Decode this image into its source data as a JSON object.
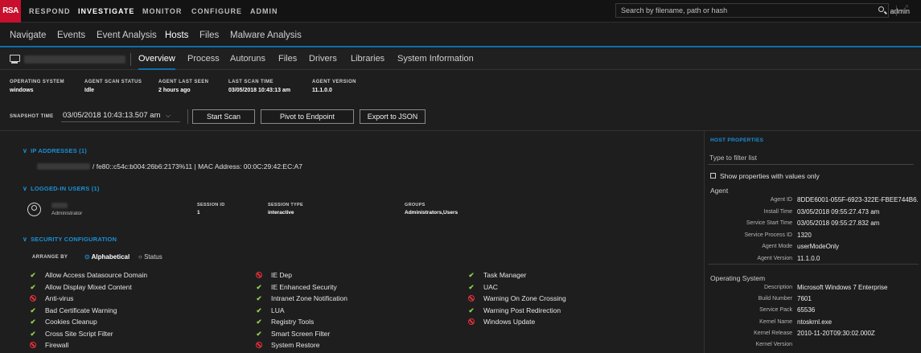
{
  "topbar": {
    "logo": "RSA",
    "nav": [
      "RESPOND",
      "INVESTIGATE",
      "MONITOR",
      "CONFIGURE",
      "ADMIN"
    ],
    "active": "INVESTIGATE",
    "user": "admin"
  },
  "subnav": {
    "items": [
      "Navigate",
      "Events",
      "Event Analysis",
      "Hosts",
      "Files",
      "Malware Analysis"
    ],
    "active": "Hosts"
  },
  "host": {
    "tabs": [
      "Overview",
      "Process",
      "Autoruns",
      "Files",
      "Drivers",
      "Libraries",
      "System Information"
    ],
    "active_tab": "Overview",
    "search_placeholder": "Search by filename, path or hash"
  },
  "summary": [
    {
      "label": "OPERATING SYSTEM",
      "value": "windows"
    },
    {
      "label": "AGENT SCAN STATUS",
      "value": "Idle"
    },
    {
      "label": "AGENT LAST SEEN",
      "value": "2 hours ago"
    },
    {
      "label": "LAST SCAN TIME",
      "value": "03/05/2018 10:43:13 am"
    },
    {
      "label": "AGENT VERSION",
      "value": "11.1.0.0"
    }
  ],
  "snapshot": {
    "label": "SNAPSHOT TIME",
    "value": "03/05/2018 10:43:13.507 am",
    "buttons": [
      "Start Scan",
      "Pivot to Endpoint",
      "Export to JSON"
    ]
  },
  "ip_section": {
    "title": "IP ADDRESSES (1)",
    "text": "/ fe80::c54c:b004:26b6:2173%11  |  MAC Address: 00:0C:29:42:EC:A7"
  },
  "users_section": {
    "title": "LOGGED-IN USERS (1)",
    "user_role": "Administrator",
    "columns": [
      {
        "label": "SESSION ID",
        "value": "1"
      },
      {
        "label": "SESSION TYPE",
        "value": "interactive"
      },
      {
        "label": "GROUPS",
        "value": "Administrators,Users"
      }
    ]
  },
  "security_section": {
    "title": "SECURITY CONFIGURATION",
    "arrange_label": "ARRANGE BY",
    "options": [
      "Alphabetical",
      "Status"
    ],
    "selected": "Alphabetical",
    "columns": [
      [
        {
          "name": "Allow Access Datasource Domain",
          "status": "ok"
        },
        {
          "name": "Allow Display Mixed Content",
          "status": "ok"
        },
        {
          "name": "Anti-virus",
          "status": "bad"
        },
        {
          "name": "Bad Certificate Warning",
          "status": "ok"
        },
        {
          "name": "Cookies Cleanup",
          "status": "ok"
        },
        {
          "name": "Cross Site Script Filter",
          "status": "ok"
        },
        {
          "name": "Firewall",
          "status": "bad"
        }
      ],
      [
        {
          "name": "IE Dep",
          "status": "bad"
        },
        {
          "name": "IE Enhanced Security",
          "status": "ok"
        },
        {
          "name": "Intranet Zone Notification",
          "status": "ok"
        },
        {
          "name": "LUA",
          "status": "ok"
        },
        {
          "name": "Registry Tools",
          "status": "ok"
        },
        {
          "name": "Smart Screen Filter",
          "status": "ok"
        },
        {
          "name": "System Restore",
          "status": "bad"
        }
      ],
      [
        {
          "name": "Task Manager",
          "status": "ok"
        },
        {
          "name": "UAC",
          "status": "ok"
        },
        {
          "name": "Warning On Zone Crossing",
          "status": "bad"
        },
        {
          "name": "Warning Post Redirection",
          "status": "ok"
        },
        {
          "name": "Windows Update",
          "status": "bad"
        }
      ]
    ]
  },
  "host_properties": {
    "title": "HOST PROPERTIES",
    "filter_placeholder": "Type to filter list",
    "checkbox_label": "Show properties with values only",
    "agent": {
      "group": "Agent",
      "rows": [
        {
          "key": "Agent ID",
          "value": "8DDE6001-055F-6923-322E-FBEE744B6..."
        },
        {
          "key": "Install Time",
          "value": "03/05/2018 09:55:27.473 am"
        },
        {
          "key": "Service Start Time",
          "value": "03/05/2018 09:55:27.832 am"
        },
        {
          "key": "Service Process ID",
          "value": "1320"
        },
        {
          "key": "Agent Mode",
          "value": "userModeOnly"
        },
        {
          "key": "Agent Version",
          "value": "11.1.0.0"
        }
      ]
    },
    "os": {
      "group": "Operating System",
      "rows": [
        {
          "key": "Description",
          "value": "Microsoft Windows 7 Enterprise"
        },
        {
          "key": "Build Number",
          "value": "7601"
        },
        {
          "key": "Service Pack",
          "value": "65536"
        },
        {
          "key": "Kernel Name",
          "value": "ntoskrnl.exe"
        },
        {
          "key": "Kernel Release",
          "value": "2010-11-20T09:30:02.000Z"
        },
        {
          "key": "Kernel Version",
          "value": ""
        }
      ]
    }
  },
  "colors": {
    "accent": "#1a8fd6",
    "brand": "#c8102e",
    "ok": "#8fd14f",
    "bad": "#e8303a"
  },
  "icons": [
    "user-icon",
    "computer-icon",
    "search-icon",
    "expand-icon",
    "check-icon",
    "blocked-icon",
    "avatar-icon"
  ]
}
